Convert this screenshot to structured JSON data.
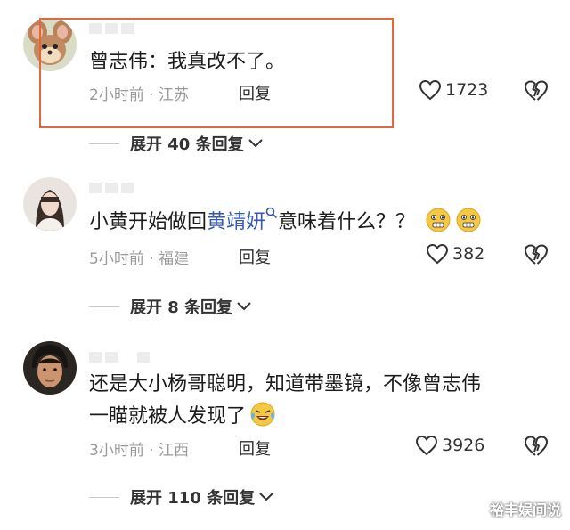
{
  "comments": [
    {
      "text": "曾志伟：我真改不了。",
      "meta": "2小时前 · 江苏",
      "reply_label": "回复",
      "likes": "1723",
      "expand_label": "展开 40 条回复"
    },
    {
      "text_before": "小黄开始做回",
      "text_link": "黄靖妍",
      "text_after": "意味着什么？？",
      "meta": "5小时前 · 福建",
      "reply_label": "回复",
      "likes": "382",
      "expand_label": "展开 8 条回复"
    },
    {
      "text_line1": "还是大小杨哥聪明，知道带墨镜，不像曾志伟",
      "text_line2": "一瞄就被人发现了",
      "meta": "3小时前 · 江西",
      "reply_label": "回复",
      "likes": "3926",
      "expand_label": "展开 110 条回复"
    }
  ],
  "watermark": "裕丰娱间说",
  "colors": {
    "highlight_border": "#e2673c",
    "link": "#3556b5",
    "meta": "#9a9a9a"
  }
}
